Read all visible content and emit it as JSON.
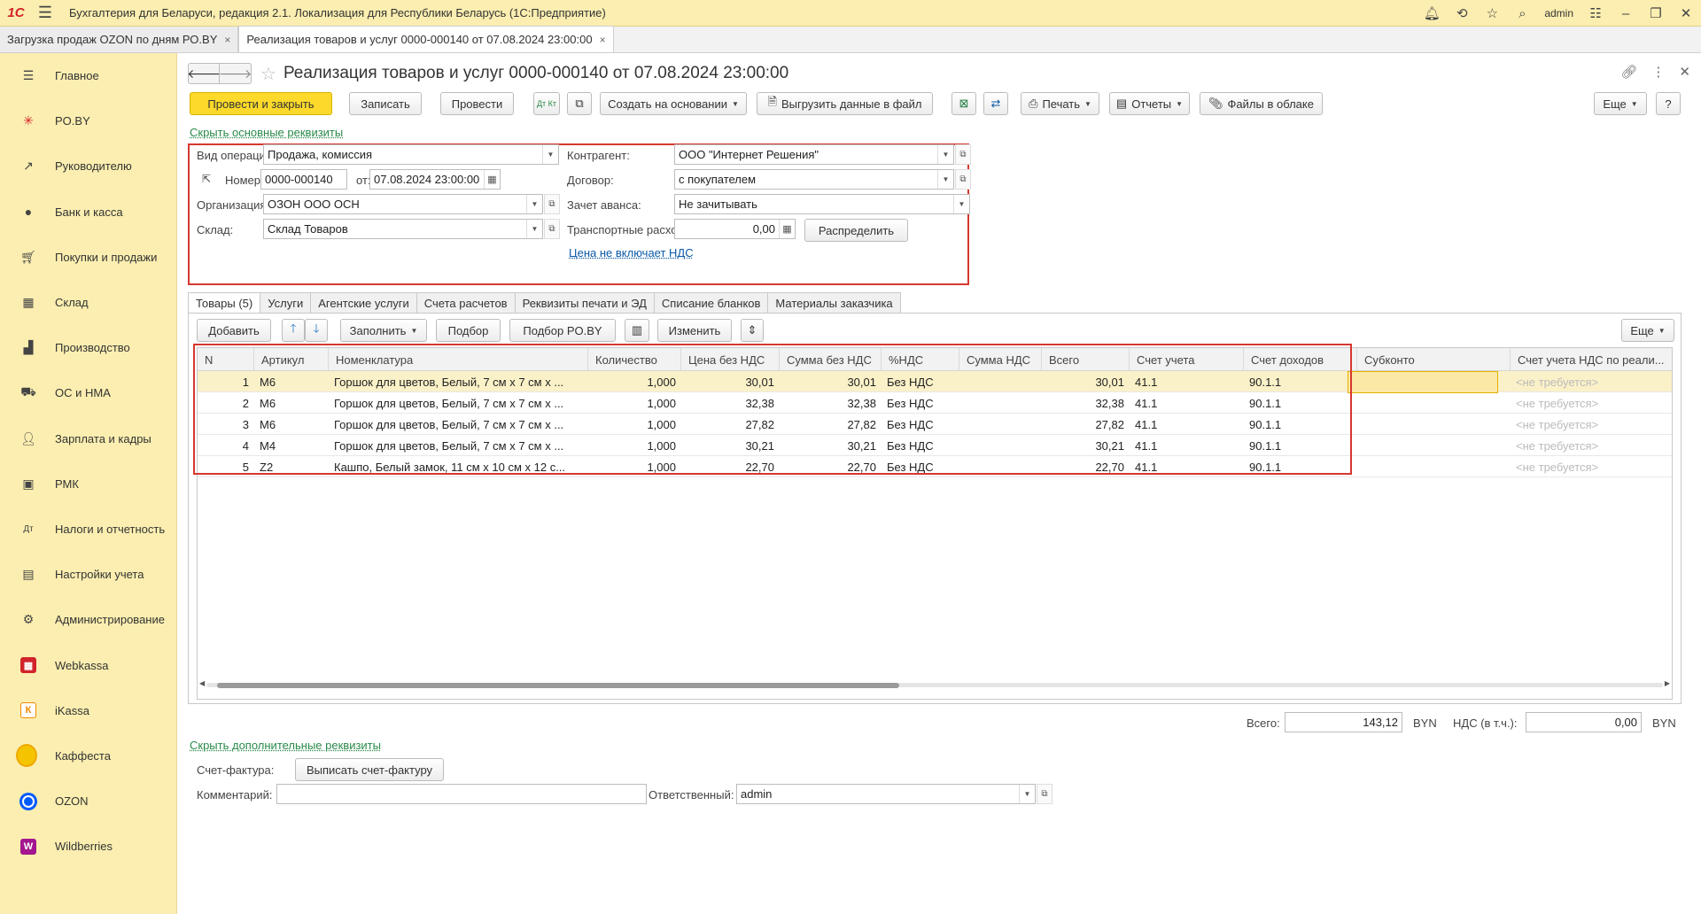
{
  "titlebar": {
    "logo": "1С",
    "title": "Бухгалтерия для Беларуси, редакция 2.1. Локализация для Республики Беларусь   (1С:Предприятие)",
    "user": "admin"
  },
  "window_tabs": [
    {
      "label": "Загрузка продаж OZON по дням РО.BY",
      "close": "×"
    },
    {
      "label": "Реализация товаров и услуг 0000-000140 от 07.08.2024 23:00:00",
      "close": "×"
    }
  ],
  "sidebar": {
    "items": [
      {
        "label": "Главное",
        "icon": "menu-icon"
      },
      {
        "label": "PO.BY",
        "icon": "pobys-icon"
      },
      {
        "label": "Руководителю",
        "icon": "trend-icon"
      },
      {
        "label": "Банк и касса",
        "icon": "bank-icon"
      },
      {
        "label": "Покупки и продажи",
        "icon": "cart-icon"
      },
      {
        "label": "Склад",
        "icon": "warehouse-icon"
      },
      {
        "label": "Производство",
        "icon": "factory-icon"
      },
      {
        "label": "ОС и НМА",
        "icon": "truck-icon"
      },
      {
        "label": "Зарплата и кадры",
        "icon": "person-icon"
      },
      {
        "label": "РМК",
        "icon": "cashbox-icon"
      },
      {
        "label": "Налоги и отчетность",
        "icon": "tax-icon"
      },
      {
        "label": "Настройки учета",
        "icon": "settings-doc-icon"
      },
      {
        "label": "Администрирование",
        "icon": "gear-icon"
      },
      {
        "label": "Webkassa",
        "icon": "webkassa-icon"
      },
      {
        "label": "iKassa",
        "icon": "ikassa-icon"
      },
      {
        "label": "Каффеста",
        "icon": "kaffesta-icon"
      },
      {
        "label": "OZON",
        "icon": "ozon-icon"
      },
      {
        "label": "Wildberries",
        "icon": "wildberries-icon"
      }
    ]
  },
  "document": {
    "title": "Реализация товаров и услуг 0000-000140 от 07.08.2024 23:00:00"
  },
  "toolbar": {
    "post_close": "Провести и закрыть",
    "save": "Записать",
    "post": "Провести",
    "dt_kt": "Дт Кт",
    "create_based": "Создать на основании",
    "export_file": "Выгрузить данные в файл",
    "print": "Печать",
    "reports": "Отчеты",
    "cloud_files": "Файлы в облаке",
    "more": "Еще",
    "help": "?"
  },
  "links": {
    "hide_main": "Скрыть основные реквизиты",
    "vat_note": "Цена не включает НДС",
    "hide_extra": "Скрыть дополнительные реквизиты"
  },
  "form": {
    "operation_label": "Вид операции:",
    "operation_value": "Продажа, комиссия",
    "number_label": "Номер:",
    "number_value": "0000-000140",
    "from_label": "от:",
    "date_value": "07.08.2024 23:00:00",
    "org_label": "Организация:",
    "org_value": "ОЗОН ООО ОСН",
    "warehouse_label": "Склад:",
    "warehouse_value": "Склад Товаров",
    "counterparty_label": "Контрагент:",
    "counterparty_value": "ООО \"Интернет Решения\"",
    "contract_label": "Договор:",
    "contract_value": "с покупателем",
    "advance_label": "Зачет аванса:",
    "advance_value": "Не зачитывать",
    "transport_label": "Транспортные расходы:",
    "transport_value": "0,00",
    "distribute": "Распределить"
  },
  "tabs": [
    "Товары (5)",
    "Услуги",
    "Агентские услуги",
    "Счета расчетов",
    "Реквизиты печати и ЭД",
    "Списание бланков",
    "Материалы заказчика"
  ],
  "table_toolbar": {
    "add": "Добавить",
    "fill": "Заполнить",
    "pick": "Подбор",
    "pick_po": "Подбор PO.BY",
    "change": "Изменить",
    "more": "Еще"
  },
  "table": {
    "columns": [
      "N",
      "Артикул",
      "Номенклатура",
      "Количество",
      "Цена без НДС",
      "Сумма без НДС",
      "%НДС",
      "Сумма НДС",
      "Всего",
      "Счет учета",
      "Счет доходов",
      "Субконто",
      "Счет учета НДС по реали..."
    ],
    "rows": [
      [
        "1",
        "M6",
        "Горшок для цветов, Белый, 7 см х 7 см х ...",
        "1,000",
        "30,01",
        "30,01",
        "Без НДС",
        "",
        "30,01",
        "41.1",
        "90.1.1",
        "",
        "<не требуется>"
      ],
      [
        "2",
        "M6",
        "Горшок для цветов, Белый, 7 см х 7 см х ...",
        "1,000",
        "32,38",
        "32,38",
        "Без НДС",
        "",
        "32,38",
        "41.1",
        "90.1.1",
        "",
        "<не требуется>"
      ],
      [
        "3",
        "M6",
        "Горшок для цветов, Белый, 7 см х 7 см х ...",
        "1,000",
        "27,82",
        "27,82",
        "Без НДС",
        "",
        "27,82",
        "41.1",
        "90.1.1",
        "",
        "<не требуется>"
      ],
      [
        "4",
        "M4",
        "Горшок для цветов, Белый, 7 см х 7 см х ...",
        "1,000",
        "30,21",
        "30,21",
        "Без НДС",
        "",
        "30,21",
        "41.1",
        "90.1.1",
        "",
        "<не требуется>"
      ],
      [
        "5",
        "Z2",
        "Кашпо, Белый замок, 11 см х 10 см х 12 с...",
        "1,000",
        "22,70",
        "22,70",
        "Без НДС",
        "",
        "22,70",
        "41.1",
        "90.1.1",
        "",
        "<не требуется>"
      ]
    ]
  },
  "totals": {
    "total_label": "Всего:",
    "total_value": "143,12",
    "currency": "BYN",
    "vat_label": "НДС (в т.ч.):",
    "vat_value": "0,00",
    "vat_currency": "BYN"
  },
  "footer": {
    "invoice_label": "Счет-фактура:",
    "invoice_button": "Выписать счет-фактуру",
    "comment_label": "Комментарий:",
    "comment_value": "",
    "responsible_label": "Ответственный:",
    "responsible_value": "admin"
  },
  "colors": {
    "sidebar_bg": "#fbeeb0",
    "primary_button": "#fcd92a",
    "highlight_frame": "#d6382f",
    "link_green": "#2a8a4a",
    "link_blue": "#0b5aa8"
  }
}
